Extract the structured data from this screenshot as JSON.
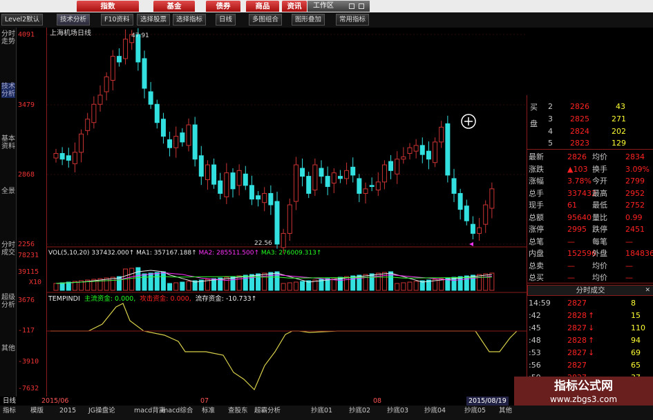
{
  "menu_tabs": [
    "指数",
    "基金",
    "债券",
    "商品",
    "资讯"
  ],
  "workspace_label": "工作区",
  "toolbar": [
    "Level2默认",
    "技术分析",
    "F10资料",
    "选择股票",
    "选择指标",
    "日线",
    "多图组合",
    "图形叠加",
    "常用指标"
  ],
  "side_tabs": [
    "分时走势",
    "技术分析",
    "基本资料",
    "全景",
    "分时成交",
    "超级分析",
    "其他"
  ],
  "y_axis": {
    "price": [
      "4091",
      "3479",
      "2868",
      "2256"
    ],
    "volume": [
      "78231",
      "39115",
      "X10"
    ],
    "indicator": [
      "3676",
      "-117",
      "-3910",
      "-7632"
    ]
  },
  "price_panel": {
    "title": "上海机场日线",
    "high_label": "47.91",
    "low_label": "22.56"
  },
  "vol_panel": {
    "header": "VOL(5,10,20)",
    "vol": "337432.000↑",
    "ma1": "MA1: 357167.188↑",
    "ma2": "MA2: 285511.500↑",
    "ma3": "MA3: 276009.313↑"
  },
  "ind_panel": {
    "name": "TEMPINDI",
    "main": "主流资金: 0.000,",
    "attack": "攻击资金: 0.000,",
    "flow": "流存资金: -10.733↑"
  },
  "colors": {
    "up": "#cc3333",
    "down": "#33e0e0",
    "ma1": "#e8e8e8",
    "ma2": "#ff33ff",
    "ma3": "#33ff33",
    "ind": "#d8d04a",
    "frame": "#8b1a1a"
  },
  "order_book": {
    "side_label": "买盘",
    "rows": [
      {
        "n": "2",
        "price": "2826",
        "vol": "43"
      },
      {
        "n": "3",
        "price": "2825",
        "vol": "271"
      },
      {
        "n": "4",
        "price": "2824",
        "vol": "202"
      },
      {
        "n": "5",
        "price": "2823",
        "vol": "129"
      }
    ]
  },
  "quote": [
    {
      "k1": "最新",
      "v1": "2826",
      "k2": "均价",
      "v2": "2834"
    },
    {
      "k1": "涨跌",
      "v1": "▲103",
      "k2": "换手",
      "v2": "3.09%"
    },
    {
      "k1": "涨幅",
      "v1": "3.78%",
      "k2": "今开",
      "v2": "2799"
    },
    {
      "k1": "总手",
      "v1": "337432",
      "k2": "最高",
      "v2": "2952"
    },
    {
      "k1": "现手",
      "v1": "61",
      "k2": "最低",
      "v2": "2752"
    },
    {
      "k1": "总额",
      "v1": "95640",
      "k2": "量比",
      "v2": "0.99"
    },
    {
      "k1": "涨停",
      "v1": "2995",
      "k2": "跌停",
      "v2": "2451"
    },
    {
      "k1": "总笔",
      "v1": "—",
      "k2": "每笔",
      "v2": "—"
    },
    {
      "k1": "内盘",
      "v1": "152596",
      "k2": "外盘",
      "v2": "184836"
    },
    {
      "k1": "总卖",
      "v1": "—",
      "k2": "均价",
      "v2": "—"
    },
    {
      "k1": "总买",
      "v1": "—",
      "k2": "均价",
      "v2": "—"
    }
  ],
  "ticks_title": "分时成交",
  "ticks": [
    {
      "t": "14:59",
      "p": "2827",
      "d": "",
      "v": "8"
    },
    {
      "t": ":42",
      "p": "2828",
      "d": "↑",
      "v": "15"
    },
    {
      "t": ":45",
      "p": "2827",
      "d": "↓",
      "v": "110"
    },
    {
      "t": ":48",
      "p": "2828",
      "d": "↑",
      "v": "94"
    },
    {
      "t": ":53",
      "p": "2827",
      "d": "↓",
      "v": "69"
    },
    {
      "t": ":56",
      "p": "2827",
      "d": "",
      "v": "65"
    },
    {
      "t": ":59",
      "p": "2827",
      "d": "",
      "v": "37"
    }
  ],
  "bottom": {
    "date_start": "2015/06",
    "month_07": "07",
    "month_08": "08",
    "date_end": "2015/08/19",
    "period": "日线",
    "tabs": [
      "指标",
      "模版",
      "2015",
      "JG操盘论",
      "macd背离",
      "macd综合",
      "标准",
      "查股东",
      "超霸分析",
      "抄底01",
      "抄底02",
      "抄底03",
      "抄底04",
      "抄底05",
      "其他"
    ]
  },
  "watermark": {
    "title": "指标公式网",
    "url": "www.zbgs3.com"
  }
}
